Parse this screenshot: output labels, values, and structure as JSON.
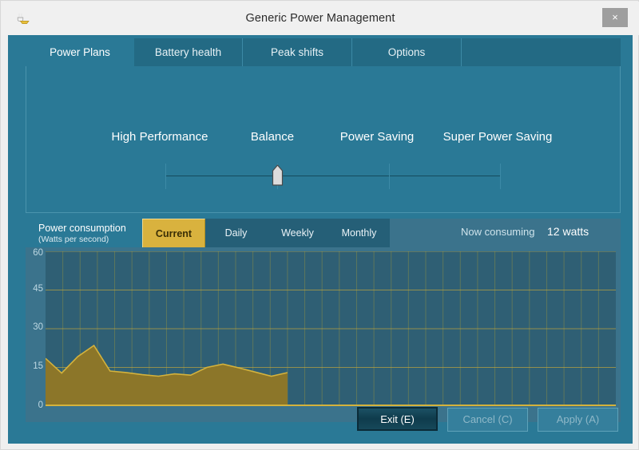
{
  "window": {
    "title": "Generic Power Management",
    "icon": "power-plug-icon",
    "close_label": "×",
    "colors": {
      "body_teal": "#2a7996",
      "panel_dark": "#236a84",
      "chart_bg": "#2f5f74",
      "chart_area": "#8c7629",
      "chart_line": "#d4b23c",
      "accent_gold": "#d9b23e",
      "titlebar": "#f0f0f0"
    }
  },
  "tabs": [
    {
      "label": "Power Plans",
      "active": true
    },
    {
      "label": "Battery health",
      "active": false
    },
    {
      "label": "Peak shifts",
      "active": false
    },
    {
      "label": "Options",
      "active": false
    }
  ],
  "power_plans": {
    "labels": [
      "High Performance",
      "Balance",
      "Power Saving",
      "Super Power Saving"
    ],
    "slider": {
      "selected": "Balance",
      "position_index": 1,
      "stops": 4
    }
  },
  "power_consumption": {
    "title": "Power consumption",
    "subtitle": "(Watts per second)",
    "range_tabs": [
      {
        "label": "Current",
        "active": true
      },
      {
        "label": "Daily",
        "active": false
      },
      {
        "label": "Weekly",
        "active": false
      },
      {
        "label": "Monthly",
        "active": false
      }
    ],
    "now_consuming_label": "Now consuming",
    "now_consuming_value": "12 watts"
  },
  "chart_data": {
    "type": "area",
    "title": "Power consumption",
    "xlabel": "",
    "ylabel": "Watts per second",
    "ylim": [
      0,
      60
    ],
    "yticks": [
      60,
      45,
      30,
      15,
      0
    ],
    "ytick_labels": [
      "60",
      "45",
      "30",
      "15",
      "0"
    ],
    "grid": true,
    "legend": "none",
    "x_grid_columns": 33,
    "filled_columns": 14,
    "series": [
      {
        "name": "Current watts per second",
        "values": [
          18.5,
          12.8,
          19.2,
          23.5,
          13.6,
          13.0,
          12.2,
          11.6,
          12.5,
          12.0,
          15.0,
          16.3,
          14.8,
          13.2,
          11.6,
          13.0
        ]
      }
    ]
  },
  "buttons": [
    {
      "label": "Exit (E)",
      "state": "focused"
    },
    {
      "label": "Cancel (C)",
      "state": "disabled"
    },
    {
      "label": "Apply (A)",
      "state": "disabled"
    }
  ]
}
